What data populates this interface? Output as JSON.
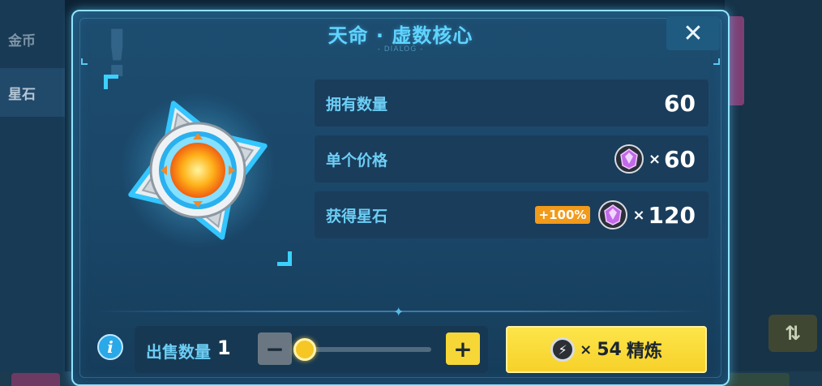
{
  "background": {
    "tabs": [
      {
        "label": "金币"
      },
      {
        "label": "星石"
      }
    ]
  },
  "dialog": {
    "title": "天命 · 虚数核心",
    "subtitle": "- DIALOG -",
    "close_label": "✕",
    "info_rows": [
      {
        "label": "拥有数量",
        "value": "60"
      },
      {
        "label": "单个价格",
        "multiplier": "×",
        "value": "60",
        "icon": "star-stone-gem-icon"
      },
      {
        "label": "获得星石",
        "bonus": "+100%",
        "multiplier": "×",
        "value": "120",
        "icon": "star-stone-gem-icon"
      }
    ],
    "sell": {
      "label": "出售数量",
      "value": "1",
      "slider_fraction": 0.0,
      "minus_label": "−",
      "plus_label": "+"
    },
    "refine_button": {
      "multiplier": "×",
      "cost": "54",
      "label": "精炼",
      "icon": "refine-coin-icon"
    }
  },
  "colors": {
    "accent": "#5fd4ff",
    "label": "#6ccef5",
    "refine_button": "#f7d12a",
    "bonus_badge": "#f29a1a",
    "dialog_border": "#8fe4ff"
  }
}
